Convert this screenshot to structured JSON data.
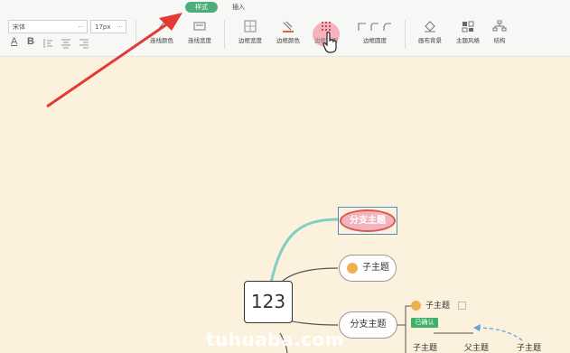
{
  "tabs": [
    {
      "label": "样式",
      "active": true
    },
    {
      "label": "插入",
      "active": false
    }
  ],
  "font": {
    "family": "宋体",
    "size": "17px",
    "more": "···"
  },
  "format_buttons": [
    "A",
    "B"
  ],
  "tools": [
    {
      "icon": "line-color-icon",
      "label": "连线颜色"
    },
    {
      "icon": "line-width-icon",
      "label": "连线宽度"
    },
    {
      "icon": "border-width-icon",
      "label": "边框宽度"
    },
    {
      "icon": "border-color-icon",
      "label": "边框颜色"
    },
    {
      "icon": "border-style-icon",
      "label": "边框类型"
    },
    {
      "icon": "border-radius-icon",
      "label": "边框圆度"
    },
    {
      "icon": "canvas-background-icon",
      "label": "画布背景"
    },
    {
      "icon": "theme-style-icon",
      "label": "主题风格"
    },
    {
      "icon": "structure-icon",
      "label": "结构"
    }
  ],
  "mindmap": {
    "central": "123",
    "branch_selected": "分支主题",
    "child1": "子主题",
    "branch2": "分支主题",
    "child2": "子主题",
    "tag": "已确认",
    "bottom_child": "子主题",
    "parent_topic": "父主题",
    "right_child": "子主题"
  },
  "watermark": "tuhuaba.com",
  "colors": {
    "canvas": "#fbf1dc",
    "accent": "#4caf7a",
    "selected_fill": "#f2b5bf",
    "selected_border": "#d85a4e",
    "teal_line": "#7fd0c4",
    "arrow": "#e23b35"
  }
}
